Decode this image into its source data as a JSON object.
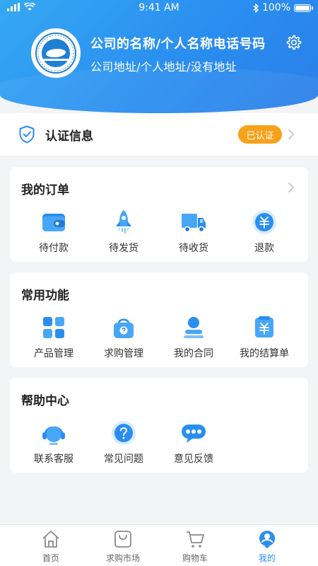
{
  "status_bar": {
    "time": "9:41 AM",
    "battery": "100%",
    "battery_level": 1.0
  },
  "profile": {
    "company_name": "公司的名称/个人名称电话号码",
    "address": "公司地址/个人地址/没有地址"
  },
  "certification": {
    "label": "认证信息",
    "badge": "已认证",
    "badge_color": "#f7a21b"
  },
  "orders": {
    "title": "我的订单",
    "items": [
      {
        "label": "待付款",
        "icon": "wallet-icon"
      },
      {
        "label": "待发货",
        "icon": "rocket-icon"
      },
      {
        "label": "待收货",
        "icon": "truck-icon"
      },
      {
        "label": "退款",
        "icon": "refund-icon"
      }
    ]
  },
  "functions": {
    "title": "常用功能",
    "items": [
      {
        "label": "产品管理",
        "icon": "grid-icon"
      },
      {
        "label": "求购管理",
        "icon": "shopping-bag-icon"
      },
      {
        "label": "我的合同",
        "icon": "contract-icon"
      },
      {
        "label": "我的结算单",
        "icon": "settlement-icon"
      }
    ]
  },
  "help": {
    "title": "帮助中心",
    "items": [
      {
        "label": "联系客服",
        "icon": "headset-icon"
      },
      {
        "label": "常见问题",
        "icon": "question-icon"
      },
      {
        "label": "意见反馈",
        "icon": "feedback-icon"
      }
    ]
  },
  "tabbar": {
    "items": [
      {
        "label": "首页",
        "icon": "home-icon",
        "active": false
      },
      {
        "label": "求购市场",
        "icon": "market-icon",
        "active": false
      },
      {
        "label": "购物车",
        "icon": "cart-icon",
        "active": false
      },
      {
        "label": "我的",
        "icon": "profile-icon",
        "active": true
      }
    ]
  },
  "colors": {
    "primary": "#2a8ef0",
    "accent_orange": "#f7a21b",
    "background": "#f3f4f6"
  }
}
